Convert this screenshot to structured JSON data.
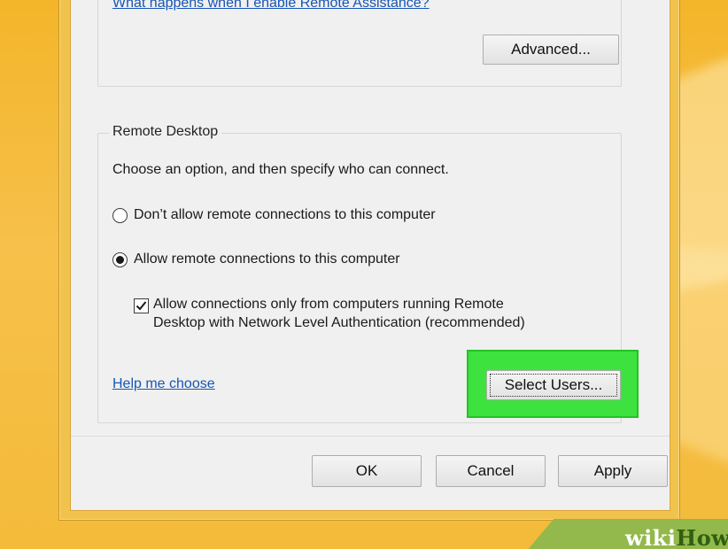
{
  "remote_assistance": {
    "help_link": "What happens when I enable Remote Assistance?",
    "advanced_button": "Advanced..."
  },
  "remote_desktop": {
    "group_title": "Remote Desktop",
    "instructions": "Choose an option, and then specify who can connect.",
    "options": [
      {
        "label": "Don’t allow remote connections to this computer",
        "selected": false
      },
      {
        "label": "Allow remote connections to this computer",
        "selected": true
      }
    ],
    "nla_checkbox": {
      "checked": true,
      "line1": "Allow connections only from computers running Remote",
      "line2": "Desktop with Network Level Authentication (recommended)"
    },
    "help_link": "Help me choose",
    "select_users_button": "Select Users..."
  },
  "footer_buttons": {
    "ok": "OK",
    "cancel": "Cancel",
    "apply": "Apply"
  },
  "watermark": {
    "part1": "wiki",
    "part2": "How"
  },
  "colors": {
    "highlight": "#3ee23e",
    "link": "#1755b5",
    "window_frame": "#f1c34d"
  }
}
